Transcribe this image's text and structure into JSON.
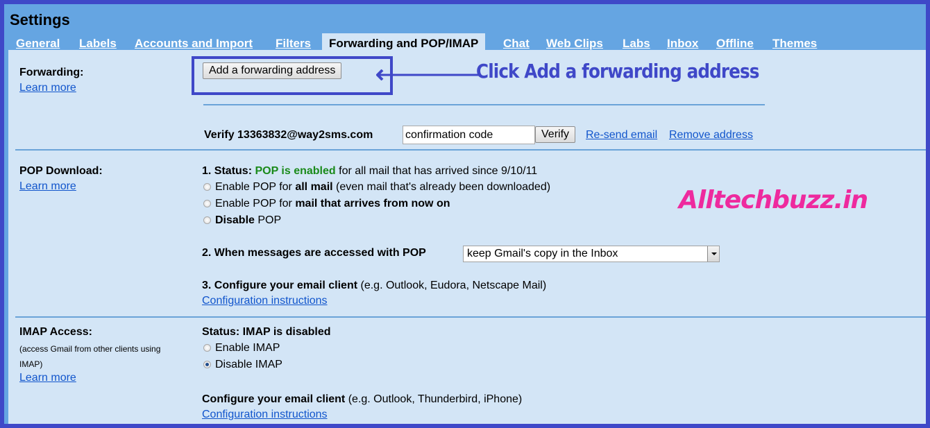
{
  "page": {
    "title": "Settings"
  },
  "tabs": [
    {
      "label": "General",
      "active": false
    },
    {
      "label": "Labels",
      "active": false
    },
    {
      "label": "Accounts and Import",
      "active": false
    },
    {
      "label": "Filters",
      "active": false
    },
    {
      "label": "Forwarding and POP/IMAP",
      "active": true
    },
    {
      "label": "Chat",
      "active": false
    },
    {
      "label": "Web Clips",
      "active": false
    },
    {
      "label": "Labs",
      "active": false
    },
    {
      "label": "Inbox",
      "active": false
    },
    {
      "label": "Offline",
      "active": false
    },
    {
      "label": "Themes",
      "active": false
    }
  ],
  "forwarding": {
    "heading": "Forwarding:",
    "learn_more": "Learn more",
    "add_button": "Add a forwarding address",
    "verify_label": "Verify 13363832@way2sms.com",
    "confirmation_input_value": "confirmation code",
    "verify_button": "Verify",
    "resend_link": "Re-send email",
    "remove_link": "Remove address"
  },
  "pop": {
    "heading": "POP Download:",
    "learn_more": "Learn more",
    "status_prefix": "1. Status: ",
    "status_value": "POP is enabled",
    "status_suffix": " for all mail that has arrived since 9/10/11",
    "options": [
      {
        "pre": "Enable POP for ",
        "bold": "all mail",
        "post": " (even mail that's already been downloaded)",
        "checked": false
      },
      {
        "pre": "Enable POP for ",
        "bold": "mail that arrives from now on",
        "post": "",
        "checked": false
      },
      {
        "pre": "",
        "bold": "Disable",
        "post": " POP",
        "checked": false
      }
    ],
    "when_accessed_label": "2. When messages are accessed with POP",
    "when_accessed_selected": "keep Gmail's copy in the Inbox",
    "configure_bold": "3. Configure your email client",
    "configure_rest": " (e.g. Outlook, Eudora, Netscape Mail)",
    "config_link": "Configuration instructions"
  },
  "imap": {
    "heading": "IMAP Access:",
    "description": "(access Gmail from other clients using IMAP)",
    "learn_more": "Learn more",
    "status": "Status: IMAP is disabled",
    "options": [
      {
        "label": "Enable IMAP",
        "checked": false
      },
      {
        "label": "Disable IMAP",
        "checked": true
      }
    ],
    "configure_bold": "Configure your email client",
    "configure_rest": " (e.g. Outlook, Thunderbird, iPhone)",
    "config_link": "Configuration instructions"
  },
  "annotation": {
    "callout_text": "Click Add a forwarding address",
    "watermark": "Alltechbuzz.in"
  },
  "colors": {
    "frame": "#3f48c8",
    "header": "#65a5e2",
    "content": "#d3e5f6",
    "link": "#1155cc",
    "status_green": "#1a8a1a",
    "watermark": "#ee2a9e"
  }
}
